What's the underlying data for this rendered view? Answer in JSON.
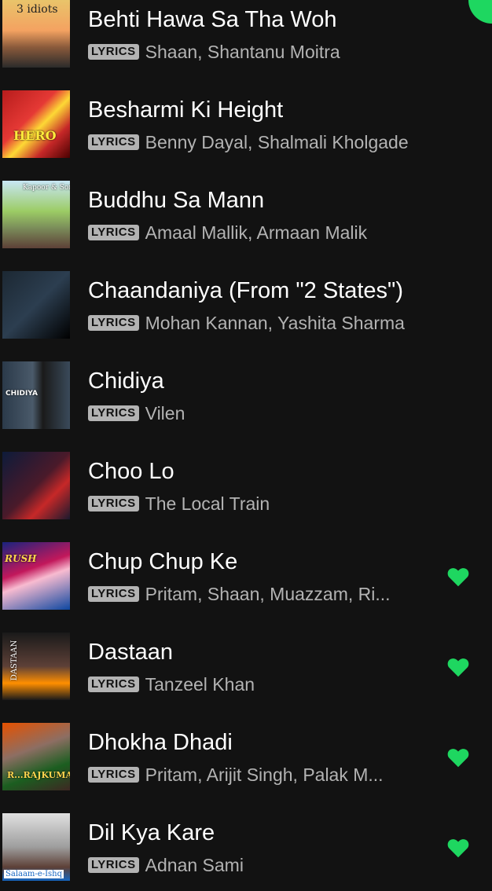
{
  "badge_label": "LYRICS",
  "tracks": [
    {
      "title": "Behti Hawa Sa Tha Woh",
      "artists": "Shaan, Shantanu Moitra",
      "liked": false,
      "cover_text": "3 idiots",
      "art": "art-3idiots"
    },
    {
      "title": "Besharmi Ki Height",
      "artists": "Benny Dayal, Shalmali Kholgade",
      "liked": false,
      "cover_text": "HERO",
      "art": "art-hero"
    },
    {
      "title": "Buddhu Sa Mann",
      "artists": "Amaal Mallik, Armaan Malik",
      "liked": false,
      "cover_text": "Kapoor & Sons",
      "art": "art-kapoor"
    },
    {
      "title": "Chaandaniya (From \"2 States\")",
      "artists": "Mohan Kannan, Yashita Sharma",
      "liked": false,
      "cover_text": "",
      "art": "art-chaandaniya"
    },
    {
      "title": "Chidiya",
      "artists": "Vilen",
      "liked": false,
      "cover_text": "CHIDIYA",
      "art": "art-chidiya"
    },
    {
      "title": "Choo Lo",
      "artists": "The Local Train",
      "liked": false,
      "cover_text": "",
      "art": "art-choolo"
    },
    {
      "title": "Chup Chup Ke",
      "artists": "Pritam, Shaan, Muazzam, Ri...",
      "liked": true,
      "cover_text": "RUSH",
      "art": "art-rush"
    },
    {
      "title": "Dastaan",
      "artists": "Tanzeel Khan",
      "liked": true,
      "cover_text": "DASTAAN",
      "art": "art-dastaan"
    },
    {
      "title": "Dhokha Dhadi",
      "artists": "Pritam, Arijit Singh, Palak M...",
      "liked": true,
      "cover_text": "R...RAJKUMAR",
      "art": "art-rajkumar"
    },
    {
      "title": "Dil Kya Kare",
      "artists": "Adnan Sami",
      "liked": true,
      "cover_text": "Salaam-e-Ishq",
      "art": "art-salaam"
    }
  ],
  "colors": {
    "background": "#121212",
    "accent_green": "#1ed760",
    "subtext": "#b3b3b3"
  },
  "icons": {
    "liked": "heart-icon"
  }
}
